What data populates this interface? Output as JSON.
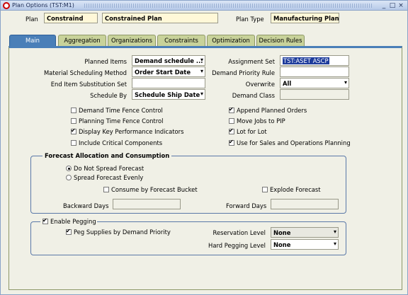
{
  "window": {
    "title": "Plan Options (TST:M1)",
    "min_glyph": "_",
    "max_glyph": "□",
    "close_glyph": "×"
  },
  "header": {
    "plan_label": "Plan",
    "plan_value": "Constraind",
    "plan_desc": "Constrained Plan",
    "plan_type_label": "Plan Type",
    "plan_type_value": "Manufacturing Plan"
  },
  "tabs": [
    "Main",
    "Aggregation",
    "Organizations",
    "Constraints",
    "Optimization",
    "Decision Rules"
  ],
  "main": {
    "planned_items_label": "Planned Items",
    "planned_items_value": "Demand schedule ...",
    "material_sched_label": "Material Scheduling Method",
    "material_sched_value": "Order Start Date",
    "end_item_label": "End Item Substitution Set",
    "end_item_value": "",
    "schedule_by_label": "Schedule By",
    "schedule_by_value": "Schedule Ship Date",
    "assignment_set_label": "Assignment Set",
    "assignment_set_value": "TST:ASET ASCP",
    "demand_priority_label": "Demand Priority Rule",
    "demand_priority_value": "",
    "overwrite_label": "Overwrite",
    "overwrite_value": "All",
    "demand_class_label": "Demand Class",
    "demand_class_value": "",
    "checks_left": [
      {
        "label": "Demand Time Fence Control",
        "checked": false
      },
      {
        "label": "Planning Time Fence Control",
        "checked": false
      },
      {
        "label": "Display Key Performance Indicators",
        "checked": true
      },
      {
        "label": "Include Critical Components",
        "checked": false
      }
    ],
    "checks_right": [
      {
        "label": "Append Planned Orders",
        "checked": true
      },
      {
        "label": "Move Jobs to PIP",
        "checked": false
      },
      {
        "label": "Lot for Lot",
        "checked": true
      },
      {
        "label": "Use for Sales and Operations Planning",
        "checked": true
      }
    ]
  },
  "forecast": {
    "title": "Forecast Allocation and Consumption",
    "radio1": "Do Not Spread Forecast",
    "radio2": "Spread Forecast Evenly",
    "selected": "Do Not Spread Forecast",
    "consume_label": "Consume by Forecast Bucket",
    "explode_label": "Explode Forecast",
    "backward_label": "Backward Days",
    "backward_value": "",
    "forward_label": "Forward Days",
    "forward_value": ""
  },
  "pegging": {
    "enable_label": "Enable Pegging",
    "enable_checked": true,
    "peg_supplies_label": "Peg Supplies by Demand Priority",
    "peg_supplies_checked": true,
    "reservation_label": "Reservation Level",
    "reservation_value": "None",
    "hard_pegging_label": "Hard Pegging Level",
    "hard_pegging_value": "None"
  },
  "icons": {
    "dropdown": "▾"
  }
}
